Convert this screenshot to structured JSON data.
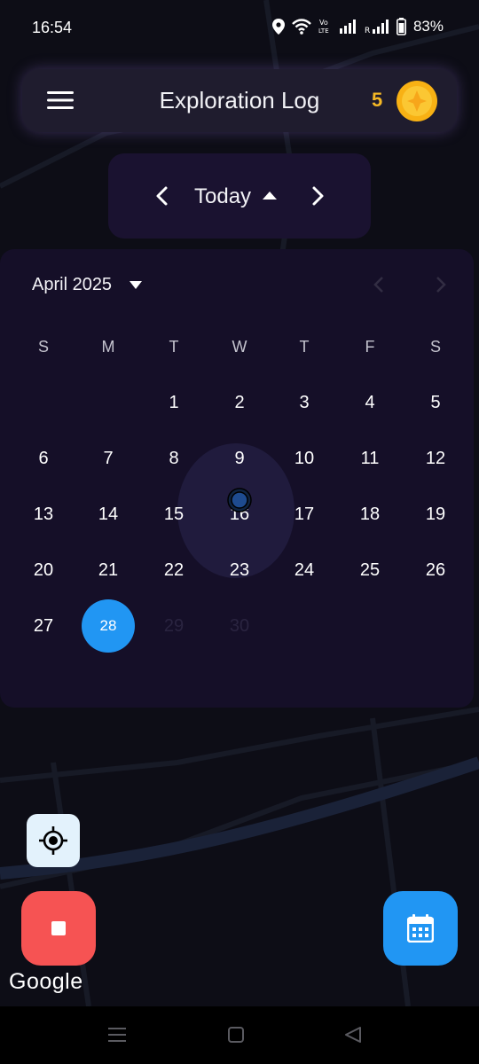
{
  "status_bar": {
    "time": "16:54",
    "battery": "83%",
    "volte_label": "Vo\nLTE",
    "roaming_label": "R"
  },
  "header": {
    "title": "Exploration Log",
    "coin_count": "5",
    "coin_color": "#f5b825"
  },
  "date_nav": {
    "label": "Today"
  },
  "calendar": {
    "month_label": "April 2025",
    "weekdays": [
      "S",
      "M",
      "T",
      "W",
      "T",
      "F",
      "S"
    ],
    "weeks": [
      [
        "",
        "",
        "1",
        "2",
        "3",
        "4",
        "5"
      ],
      [
        "6",
        "7",
        "8",
        "9",
        "10",
        "11",
        "12"
      ],
      [
        "13",
        "14",
        "15",
        "16",
        "17",
        "18",
        "19"
      ],
      [
        "20",
        "21",
        "22",
        "23",
        "24",
        "25",
        "26"
      ],
      [
        "27",
        "28",
        "29",
        "30",
        "",
        "",
        ""
      ]
    ],
    "selected_day": "28",
    "disabled_days": [
      "29",
      "30"
    ],
    "accent_color": "#2196f3"
  },
  "buttons": {
    "stop_color": "#f65353",
    "calendar_color": "#2196f3",
    "recenter_icon": "crosshair-icon"
  },
  "attribution": {
    "google_label": "Google"
  }
}
